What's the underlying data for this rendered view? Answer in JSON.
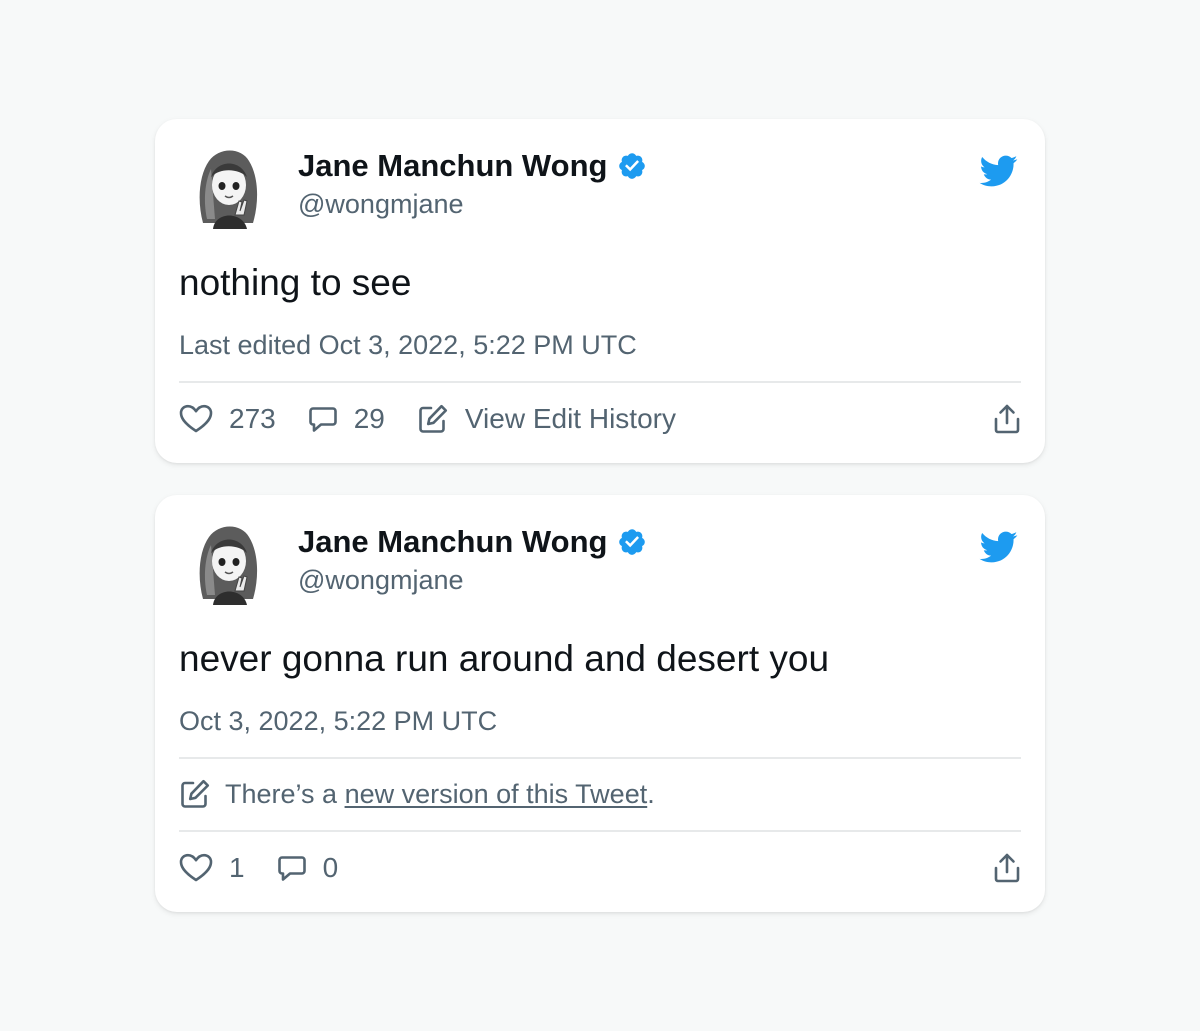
{
  "colors": {
    "background": "#f7f9f9",
    "card": "#ffffff",
    "text_primary": "#0f1419",
    "text_secondary": "#536471",
    "twitter_blue": "#1d9bf0",
    "divider": "#e7e9ea"
  },
  "tweets": [
    {
      "author_name": "Jane Manchun Wong",
      "handle": "@wongmjane",
      "verified": true,
      "text": "nothing to see",
      "timestamp": "Last edited Oct 3, 2022, 5:22 PM UTC",
      "likes": "273",
      "replies": "29",
      "edit_history_label": "View Edit History",
      "icons": [
        "avatar",
        "verified-badge-icon",
        "twitter-bird-icon",
        "heart-icon",
        "reply-icon",
        "edit-icon",
        "share-icon"
      ]
    },
    {
      "author_name": "Jane Manchun Wong",
      "handle": "@wongmjane",
      "verified": true,
      "text": "never gonna run around and desert you",
      "timestamp": "Oct 3, 2022, 5:22 PM UTC",
      "notice_prefix": "There’s a ",
      "notice_link": "new version of this Tweet",
      "notice_suffix": ".",
      "likes": "1",
      "replies": "0",
      "icons": [
        "avatar",
        "verified-badge-icon",
        "twitter-bird-icon",
        "edit-icon",
        "heart-icon",
        "reply-icon",
        "share-icon"
      ]
    }
  ]
}
